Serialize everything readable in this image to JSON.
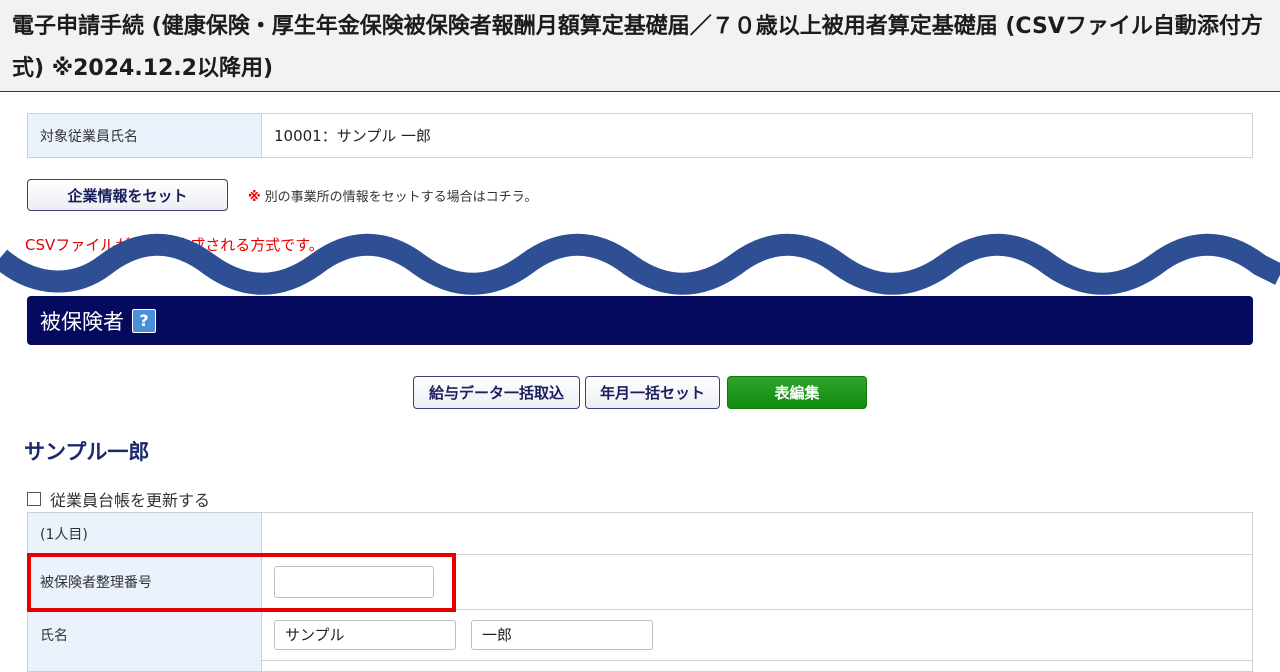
{
  "page": {
    "title": "電子申請手続 (健康保険・厚生年金保険被保険者報酬月額算定基礎届／７０歳以上被用者算定基礎届 (CSVファイル自動添付方式) ※2024.12.2以降用)"
  },
  "target_employee": {
    "label": "対象従業員氏名",
    "value": "10001：サンプル 一郎"
  },
  "company_button": {
    "label": "企業情報をセット",
    "note_mark": "※",
    "note": "別の事業所の情報をセットする場合はコチラ。"
  },
  "csv_note": "CSVファイルが自動で作成される方式です。",
  "section": {
    "title": "被保険者",
    "help": "?"
  },
  "toolbar": {
    "import_label": "給与データ一括取込",
    "month_set_label": "年月一括セット",
    "edit_table_label": "表編集"
  },
  "person": {
    "name": "サンプル一郎",
    "update_ledger_label": "従業員台帳を更新する",
    "index_label": "(1人目)",
    "insured_number_label": "被保険者整理番号",
    "insured_number_value": "",
    "name_label": "氏名",
    "last_name": "サンプル",
    "first_name": "一郎"
  },
  "colors": {
    "section_bg": "#060a5e",
    "accent_red": "#e60000",
    "green_button": "#1a921a",
    "label_bg": "#eaf2fc"
  }
}
